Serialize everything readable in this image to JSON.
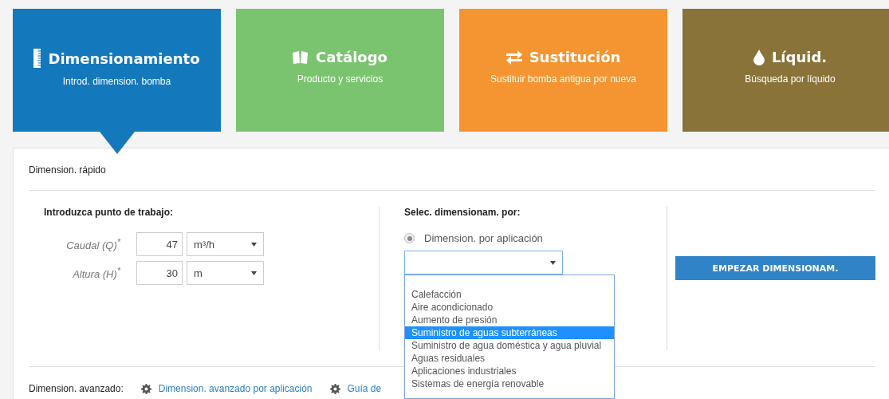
{
  "tiles": [
    {
      "kind": "ruler",
      "title": "Dimensionamiento",
      "subtitle": "Introd. dimension. bomba",
      "selected": true,
      "color": "#1478bc"
    },
    {
      "kind": "book",
      "title": "Catálogo",
      "subtitle": "Producto y servicios",
      "selected": false,
      "color": "#7bc46f"
    },
    {
      "kind": "swap",
      "title": "Sustitución",
      "subtitle": "Sustituir bomba antigua por nueva",
      "selected": false,
      "color": "#f59531"
    },
    {
      "kind": "drop",
      "title": "Líquid.",
      "subtitle": "Búsqueda por líquido",
      "selected": false,
      "color": "#8a7338"
    }
  ],
  "panel": {
    "title": "Dimension. rápido",
    "work_point": {
      "heading": "Introduzca punto de trabajo:",
      "fields": [
        {
          "label": "Caudal (Q)$^{*}$",
          "value": "47",
          "unit": "m³/h"
        },
        {
          "label": "Altura (H)$^{*}$",
          "value": "30",
          "unit": "m"
        }
      ]
    },
    "sizing_by": {
      "heading": "Selec. dimensionam. por:",
      "radio": {
        "label": "Dimension. por aplicación",
        "checked": true
      },
      "dropdown": {
        "expanded": true,
        "options": [
          {
            "label": "Calefacción",
            "selected": false
          },
          {
            "label": "Aire acondicionado",
            "selected": false
          },
          {
            "label": "Aumento de presión",
            "selected": false
          },
          {
            "label": "Suministro de aguas subterráneas",
            "selected": true
          },
          {
            "label": "Suministro de agua doméstica y agua pluvial",
            "selected": false
          },
          {
            "label": "Aguas residuales",
            "selected": false
          },
          {
            "label": "Aplicaciones industriales",
            "selected": false
          },
          {
            "label": "Sistemas de energía renovable",
            "selected": false
          }
        ]
      }
    },
    "start_button": "EMPEZAR DIMENSIONAM.",
    "advanced": {
      "label": "Dimension. avanzado:",
      "links": [
        "Dimension. avanzado por aplicación",
        "Guía de"
      ]
    }
  }
}
